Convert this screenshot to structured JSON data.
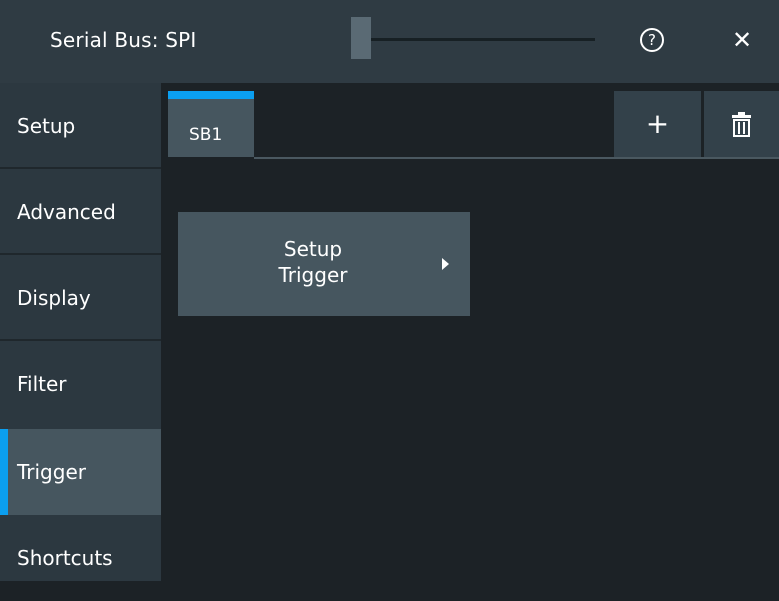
{
  "window": {
    "title": "Serial Bus: SPI",
    "help_label": "?",
    "close_label": "✕"
  },
  "sidebar": {
    "items": [
      {
        "label": "Setup",
        "active": false
      },
      {
        "label": "Advanced",
        "active": false
      },
      {
        "label": "Display",
        "active": false
      },
      {
        "label": "Filter",
        "active": false
      },
      {
        "label": "Trigger",
        "active": true
      },
      {
        "label": "Shortcuts",
        "active": false
      }
    ]
  },
  "tabs": {
    "items": [
      {
        "label": "SB1",
        "active": true
      }
    ],
    "add_label": "+",
    "delete_icon": "trash-icon"
  },
  "main": {
    "setup_trigger_label": "Setup\nTrigger"
  },
  "colors": {
    "accent": "#0b9ff0",
    "background": "#1c2226",
    "header": "#2f3b43",
    "sidebar": "#2c3840",
    "active_item": "#46565f"
  }
}
